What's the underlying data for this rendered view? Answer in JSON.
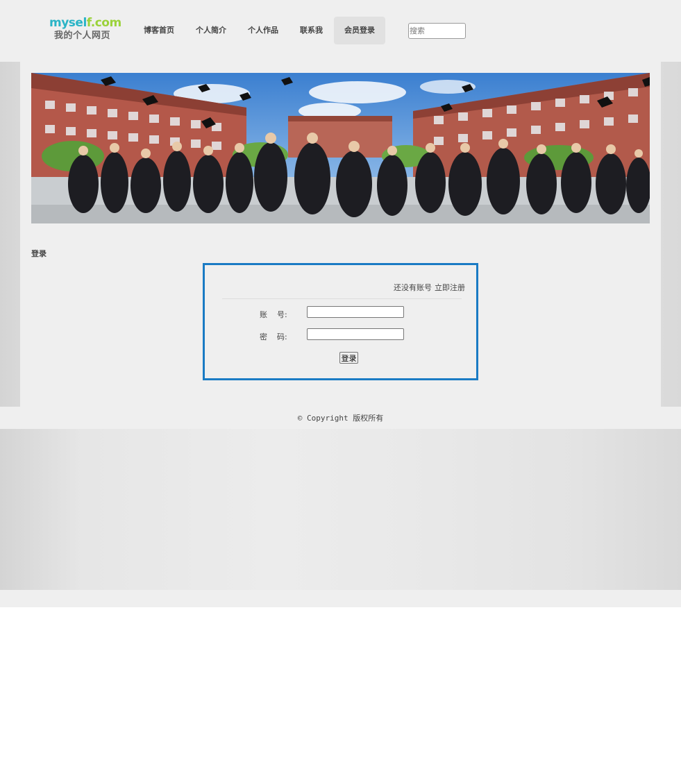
{
  "logo": {
    "top_part1": "mysel",
    "top_part2": "f.com",
    "subtitle": "我的个人网页"
  },
  "nav": {
    "items": [
      {
        "label": "博客首页"
      },
      {
        "label": "个人简介"
      },
      {
        "label": "个人作品"
      },
      {
        "label": "联系我"
      },
      {
        "label": "会员登录",
        "active": true
      }
    ]
  },
  "search": {
    "placeholder": "搜索",
    "value": ""
  },
  "banner": {
    "image": "graduation-photo"
  },
  "main": {
    "section_title": "登录"
  },
  "login": {
    "no_account_text": "还没有账号",
    "register_link": "立即注册",
    "account_label": "账    号:",
    "password_label": "密    码:",
    "account_value": "",
    "password_value": "",
    "submit_label": "登录"
  },
  "footer": {
    "copyright": "© Copyright 版权所有"
  },
  "colors": {
    "accent_border": "#1a7bc4",
    "logo_teal": "#2ab4c6",
    "logo_green": "#9bd23b",
    "panel_bg": "#efefef"
  }
}
